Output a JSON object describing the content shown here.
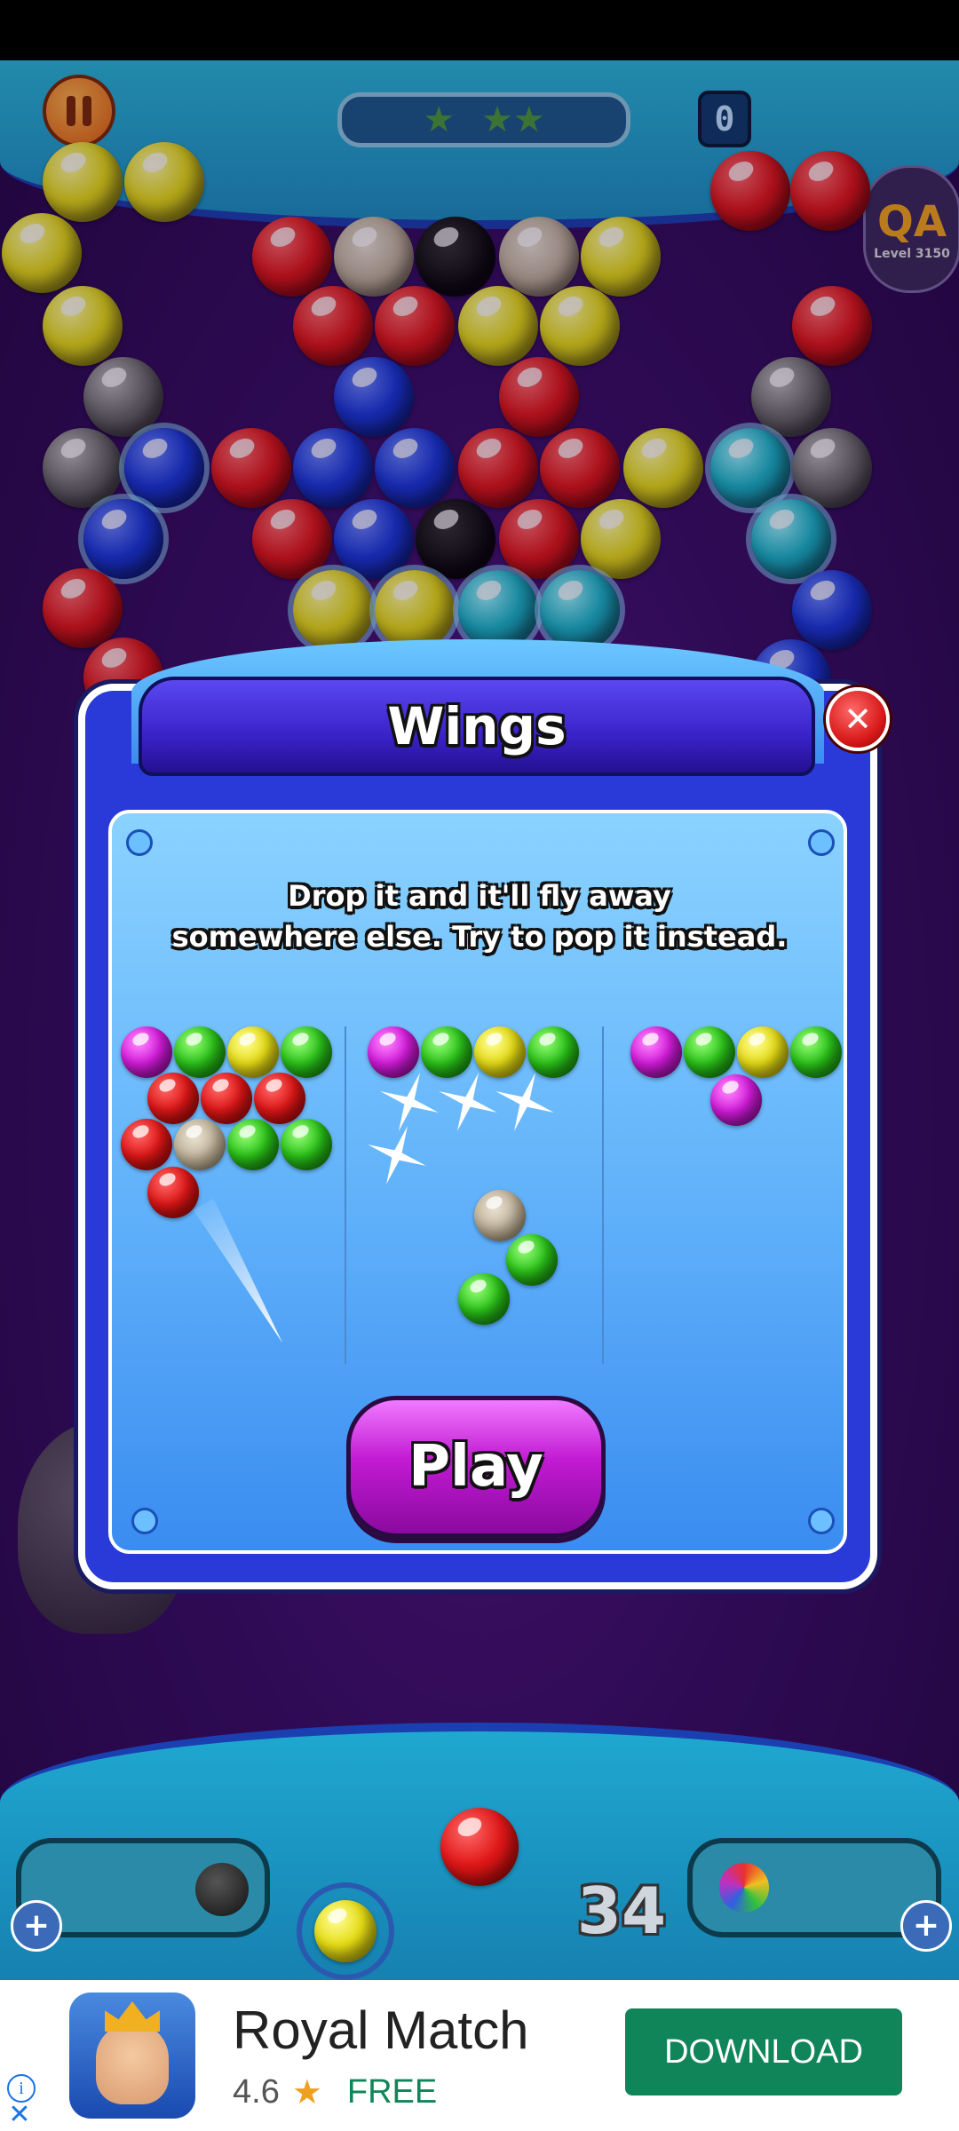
{
  "hud": {
    "score": "0",
    "stars": 3,
    "level_badge": "QA",
    "level_text": "Level 3150"
  },
  "popup": {
    "title": "Wings",
    "description_line1": "Drop it and it'll fly away",
    "description_line2": "somewhere else. Try to pop it instead.",
    "play_label": "Play",
    "close_icon": "close-icon"
  },
  "bottom_bar": {
    "moves_left": "34",
    "booster_left_icon": "bomb-icon",
    "booster_right_icon": "rainbow-ball-icon",
    "add_icon": "plus-icon"
  },
  "ad": {
    "app_name": "Royal Match",
    "rating": "4.6",
    "rating_icon": "star-icon",
    "price": "FREE",
    "cta": "DOWNLOAD",
    "info_icon": "info-icon",
    "close_icon": "close-icon"
  },
  "colors": {
    "popup_blue": "#3a8cf0",
    "title_purple": "#3a22c8",
    "play_magenta": "#c21ad2",
    "ad_green": "#10855a",
    "close_red": "#d81a1a"
  }
}
